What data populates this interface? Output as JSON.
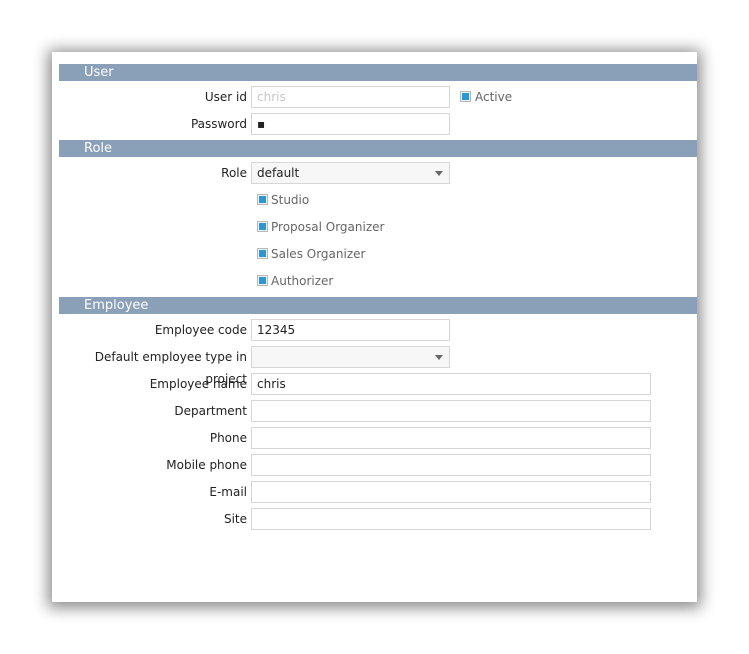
{
  "sections": {
    "user": "User",
    "role": "Role",
    "employee": "Employee"
  },
  "user": {
    "userid_label": "User id",
    "userid_value": "chris",
    "active_label": "Active",
    "active_checked": true,
    "password_label": "Password",
    "password_value": "▪"
  },
  "role": {
    "role_label": "Role",
    "role_value": "default",
    "permissions": [
      {
        "label": "Studio",
        "checked": true
      },
      {
        "label": "Proposal Organizer",
        "checked": true
      },
      {
        "label": "Sales Organizer",
        "checked": true
      },
      {
        "label": "Authorizer",
        "checked": true
      }
    ]
  },
  "employee": {
    "code_label": "Employee code",
    "code_value": "12345",
    "type_label": "Default employee type in project",
    "type_value": "",
    "name_label": "Employee name",
    "name_value": "chris",
    "department_label": "Department",
    "department_value": "",
    "phone_label": "Phone",
    "phone_value": "",
    "mobile_label": "Mobile phone",
    "mobile_value": "",
    "email_label": "E-mail",
    "email_value": "",
    "site_label": "Site",
    "site_value": ""
  },
  "colors": {
    "section_header": "#8aa0b8",
    "checkbox": "#2b98d2"
  }
}
